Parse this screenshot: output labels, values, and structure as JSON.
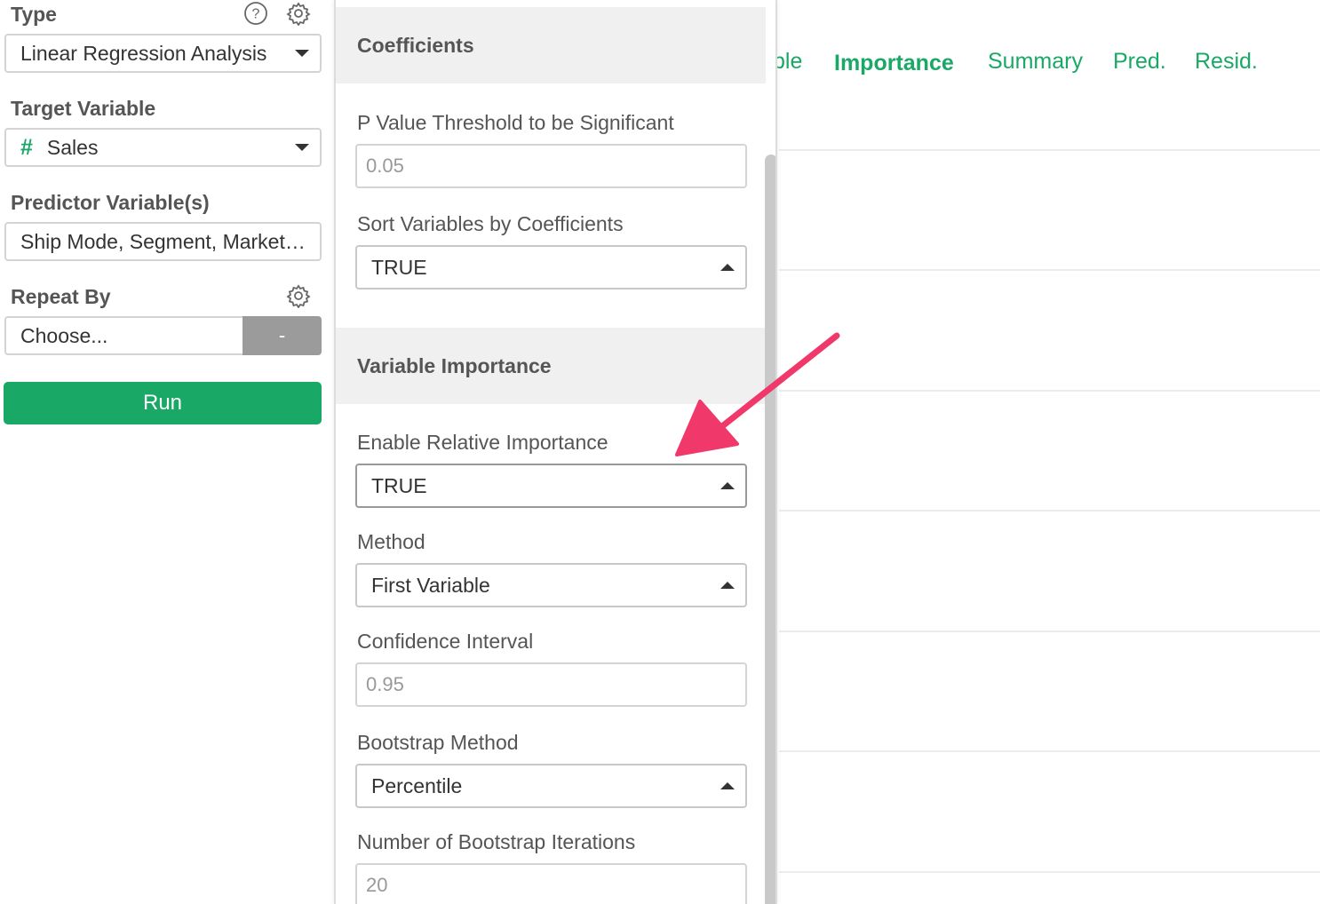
{
  "sidebar": {
    "type_label": "Type",
    "type_value": "Linear Regression Analysis",
    "target_label": "Target Variable",
    "target_value": "Sales",
    "target_type_glyph": "#",
    "predictor_label": "Predictor Variable(s)",
    "predictor_value": "Ship Mode, Segment, Market, Region, Category",
    "repeat_label": "Repeat By",
    "repeat_placeholder": "Choose...",
    "repeat_minus": "-",
    "run_label": "Run"
  },
  "icons": [
    "help-circle-icon",
    "gear-icon",
    "chevron-down-icon",
    "chevron-up-icon",
    "arrow-annotation"
  ],
  "panel": {
    "coefficients_header": "Coefficients",
    "p_value_label": "P Value Threshold to be Significant",
    "p_value_value": "0.05",
    "sort_label": "Sort Variables by Coefficients",
    "sort_value": "TRUE",
    "importance_header": "Variable Importance",
    "relative_label": "Enable Relative Importance",
    "relative_value": "TRUE",
    "method_label": "Method",
    "method_value": "First Variable",
    "ci_label": "Confidence Interval",
    "ci_value": "0.95",
    "bootstrap_label": "Bootstrap Method",
    "bootstrap_value": "Percentile",
    "iterations_label": "Number of Bootstrap Iterations",
    "iterations_value": "20"
  },
  "tabs": [
    {
      "label": "ble",
      "active": false
    },
    {
      "label": "Importance",
      "active": true
    },
    {
      "label": "Summary",
      "active": false
    },
    {
      "label": "Pred.",
      "active": false
    },
    {
      "label": "Resid.",
      "active": false
    }
  ],
  "colors": {
    "accent": "#1aa866",
    "arrow": "#f0386b",
    "section_bg": "#f0f0f0",
    "minus_button": "#9b9b9b"
  }
}
